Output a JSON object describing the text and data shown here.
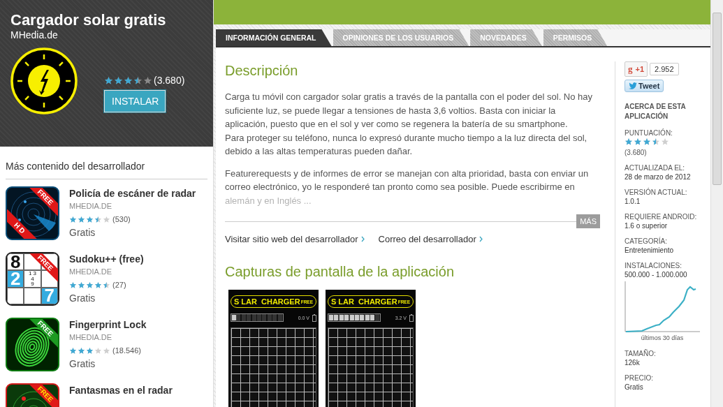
{
  "app": {
    "title": "Cargador solar gratis",
    "developer": "MHedia.de",
    "stars": 3.5,
    "rating_count": "(3.680)",
    "install_button": "INSTALAR"
  },
  "more_from_developer": {
    "heading": "Más contenido del desarrollador",
    "items": [
      {
        "kind": "radar",
        "name": "Policía de escáner de radar",
        "developer": "MHEDIA.DE",
        "stars": 3.5,
        "count": "(530)",
        "price": "Gratis",
        "ribbon": "FREE",
        "corner": "H D"
      },
      {
        "kind": "sudoku",
        "name": "Sudoku++ (free)",
        "developer": "MHEDIA.DE",
        "stars": 4.5,
        "count": "(27)",
        "price": "Gratis",
        "ribbon": "FREE",
        "cells": [
          "8",
          "",
          "",
          "2",
          "1 3\n4\n9",
          "",
          "",
          "",
          "7"
        ]
      },
      {
        "kind": "fingerprint",
        "name": "Fingerprint Lock",
        "developer": "MHEDIA.DE",
        "stars": 3,
        "count": "(18.546)",
        "price": "Gratis",
        "ribbon": "FREE"
      },
      {
        "kind": "ghost-radar",
        "name": "Fantasmas en el radar",
        "ribbon": "FREE"
      }
    ]
  },
  "tabs": [
    {
      "label": "INFORMACIÓN GENERAL",
      "selected": true
    },
    {
      "label": "OPINIONES DE LOS USUARIOS",
      "selected": false
    },
    {
      "label": "NOVEDADES",
      "selected": false
    },
    {
      "label": "PERMISOS",
      "selected": false
    }
  ],
  "description": {
    "heading": "Descripción",
    "paragraphs": [
      "Carga tu móvil con cargador solar gratis a través de la pantalla con el poder del sol. No hay suficiente luz, se puede llegar a tensiones de hasta 3,6 voltios. Basta con iniciar la aplicación, puesto que en el sol y ver como se regenera la batería de su smartphone.\nPara proteger su teléfono, nunca lo expresó durante mucho tiempo a la luz directa del sol, debido a las altas temperaturas pueden dañar.",
      "Featurerequests y de informes de error se manejan con alta prioridad, basta con enviar un correo electrónico, yo le responderé tan pronto como sea posible. Puede escribirme en alemán y en Inglés ..."
    ],
    "more_button": "MÁS",
    "links": [
      "Visitar sitio web del desarrollador",
      "Correo del desarrollador"
    ]
  },
  "screenshots": {
    "heading": "Capturas de pantalla de la aplicación",
    "items": [
      {
        "logo_start": "S",
        "logo_end": "LAR  CHARGER",
        "badge": "FREE",
        "level": 0.1,
        "reading": "0.0 V"
      },
      {
        "logo_start": "S",
        "logo_end": "LAR  CHARGER",
        "badge": "FREE",
        "level": 0.9,
        "reading": "3.2 V"
      }
    ]
  },
  "social": {
    "plus_logo": "g",
    "plus_one": "+1",
    "plus_count": "2.952",
    "tweet": "Tweet"
  },
  "about": {
    "heading": "ACERCA DE ESTA APLICACIÓN",
    "facts": [
      {
        "kind": "rating",
        "label": "PUNTUACIÓN:",
        "stars": 3.5,
        "value": "(3.680)"
      },
      {
        "kind": "text",
        "label": "ACTUALIZADA EL:",
        "value": "28 de marzo de 2012"
      },
      {
        "kind": "text",
        "label": "VERSIÓN ACTUAL:",
        "value": "1.0.1"
      },
      {
        "kind": "text",
        "label": "REQUIERE ANDROID:",
        "value": "1.6 o superior"
      },
      {
        "kind": "text",
        "label": "CATEGORÍA:",
        "value": "Entretenimiento"
      },
      {
        "kind": "chart",
        "label": "INSTALACIONES:",
        "value": "500.000 - 1.000.000",
        "caption": "últimos 30 días"
      },
      {
        "kind": "text",
        "label": "TAMAÑO:",
        "value": "126k"
      },
      {
        "kind": "text",
        "label": "PRECIO:",
        "value": "Gratis"
      }
    ]
  }
}
